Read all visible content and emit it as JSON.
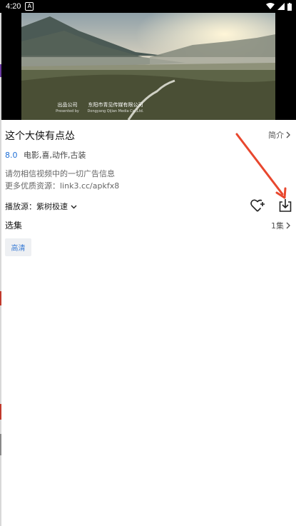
{
  "status_bar": {
    "time": "4:20",
    "notification": "A"
  },
  "player": {
    "credit_left": "出品公司",
    "credit_left_sub": "Presented by",
    "credit_right": "东阳市青见传媒有限公司",
    "credit_right_sub": "Dongyang Qijian Media Co.,Ltd."
  },
  "detail": {
    "title": "这个大侠有点怂",
    "intro_label": "简介",
    "score": "8.0",
    "tags": "电影,喜,动作,古装",
    "notice_line1": "请勿相信视频中的一切广告信息",
    "notice_line2": "更多优质资源：link3.cc/apkfx8"
  },
  "source": {
    "label": "播放源：紫树极速"
  },
  "episodes": {
    "heading": "选集",
    "count": "1集",
    "items": [
      "高清"
    ]
  },
  "colors": {
    "accent": "#1f6fd6",
    "arrow": "#e8472e"
  }
}
